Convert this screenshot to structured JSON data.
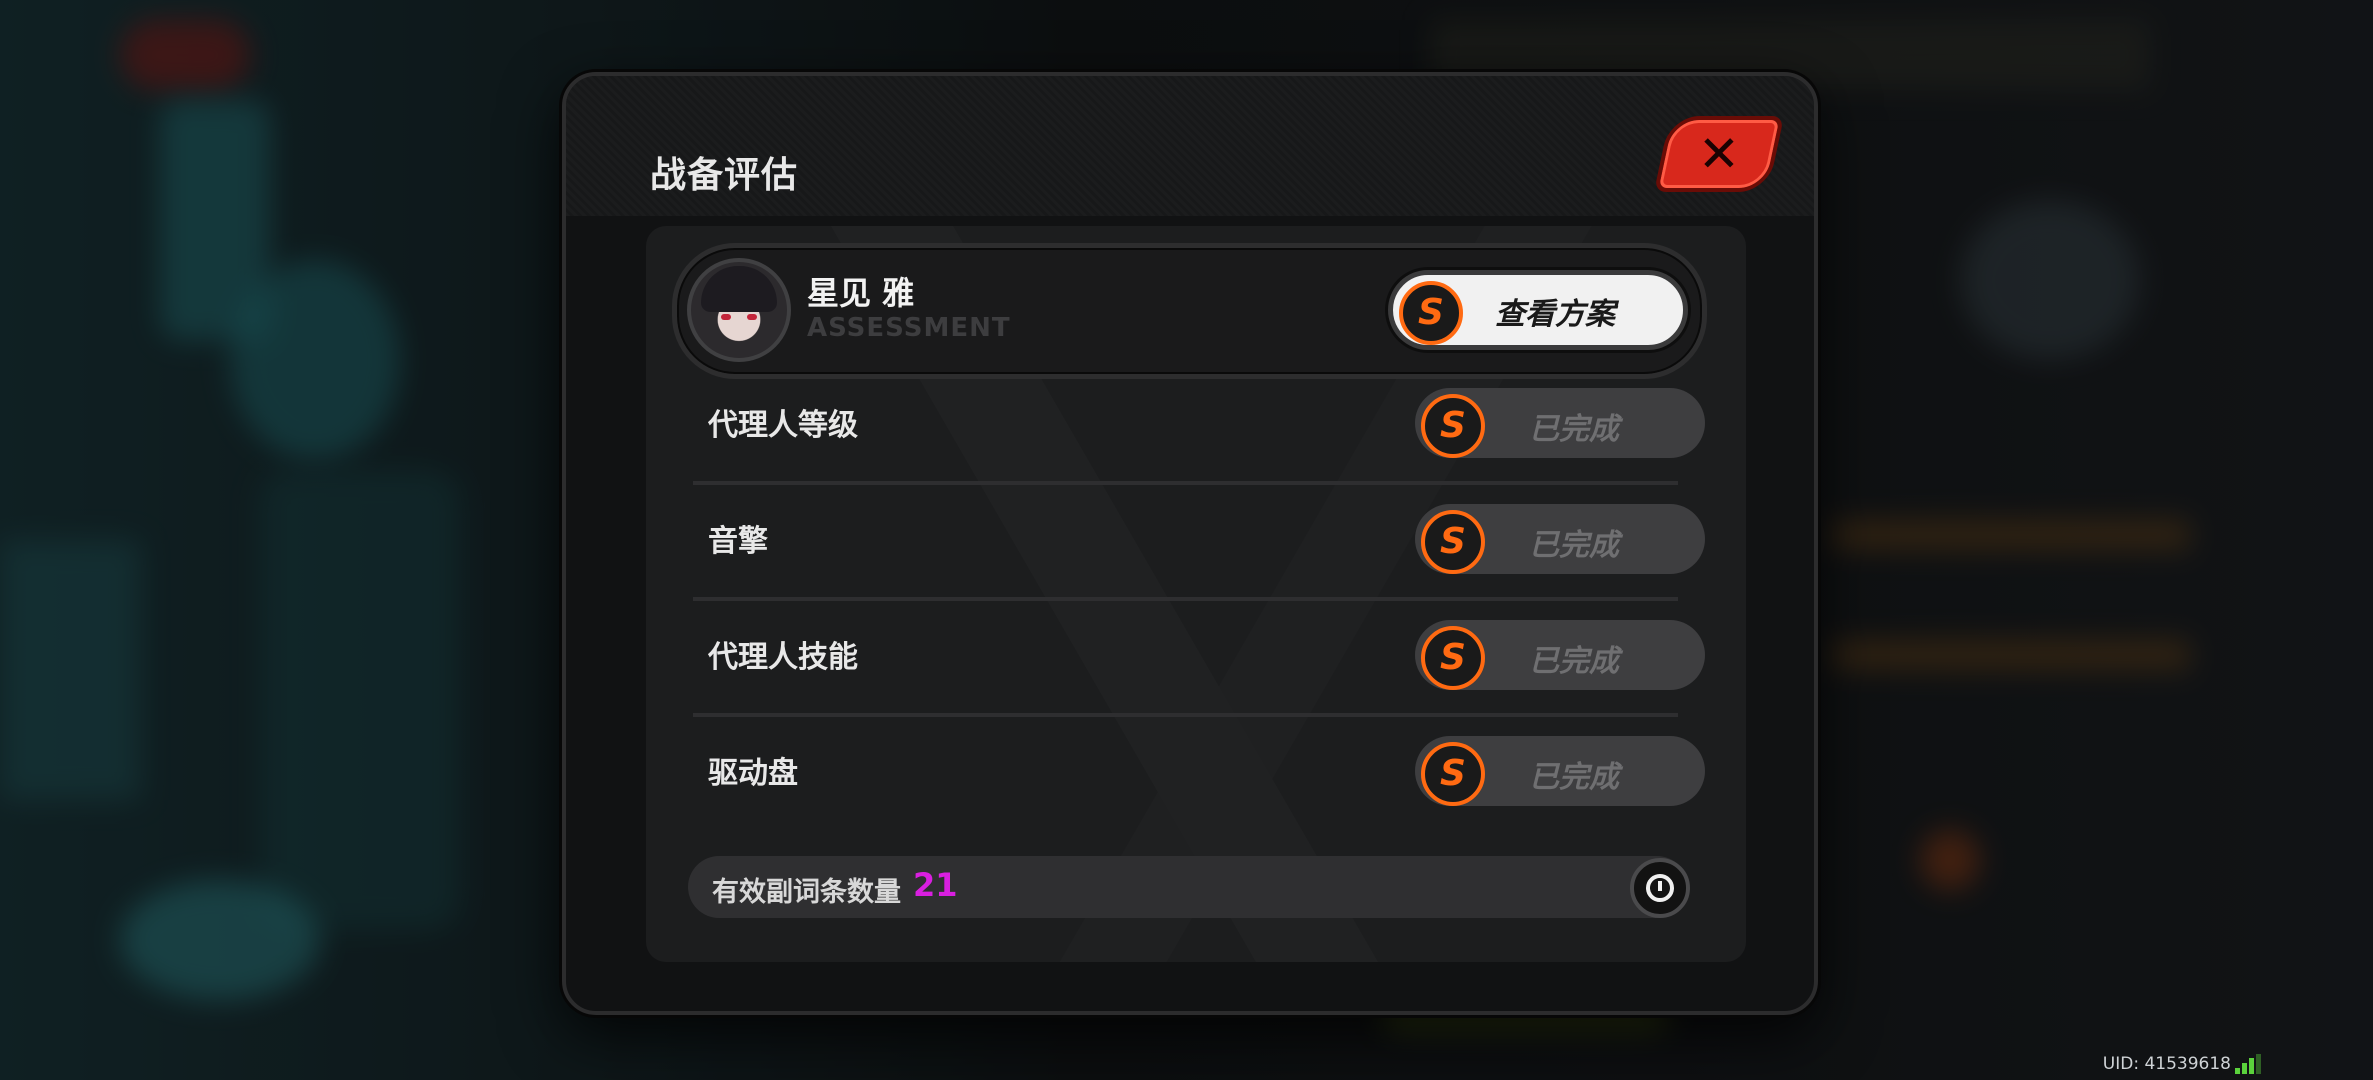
{
  "dialog": {
    "title": "战备评估",
    "close_icon": "close-x-icon"
  },
  "character": {
    "name": "星见 雅",
    "subtitle": "ASSESSMENT",
    "view_plan_label": "查看方案",
    "rank": "S"
  },
  "evaluations": [
    {
      "label": "代理人等级",
      "rank": "S",
      "status": "已完成"
    },
    {
      "label": "音擎",
      "rank": "S",
      "status": "已完成"
    },
    {
      "label": "代理人技能",
      "rank": "S",
      "status": "已完成"
    },
    {
      "label": "驱动盘",
      "rank": "S",
      "status": "已完成"
    }
  ],
  "substats": {
    "label": "有效副词条数量",
    "value": "21",
    "value_color": "#d91fe0"
  },
  "footer": {
    "uid": "UID: 41539618"
  },
  "colors": {
    "accent_orange": "#ff6a12",
    "close_red": "#d8281c",
    "signal_green": "#5bd23c"
  }
}
